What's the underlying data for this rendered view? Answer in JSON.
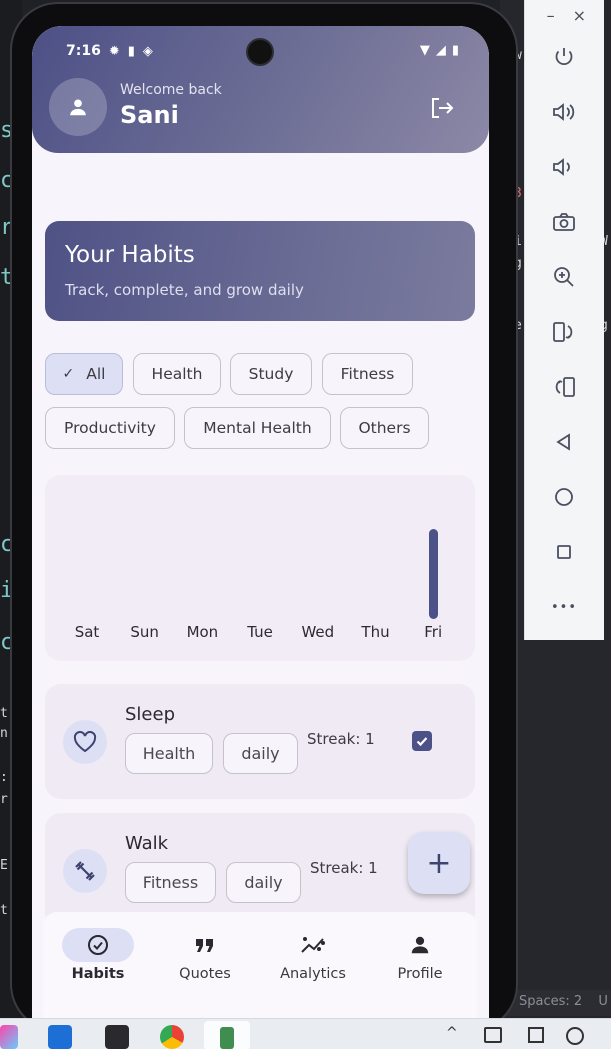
{
  "status_bar": {
    "time": "7:16"
  },
  "header": {
    "welcome": "Welcome back",
    "username": "Sani"
  },
  "hero": {
    "title": "Your Habits",
    "subtitle": "Track, complete, and grow daily"
  },
  "filters": {
    "selected": "All",
    "chips": [
      "All",
      "Health",
      "Study",
      "Fitness",
      "Productivity",
      "Mental Health",
      "Others"
    ]
  },
  "chart_data": {
    "type": "bar",
    "categories": [
      "Sat",
      "Sun",
      "Mon",
      "Tue",
      "Wed",
      "Thu",
      "Fri"
    ],
    "values": [
      0,
      0,
      0,
      0,
      0,
      0,
      1
    ],
    "title": "",
    "xlabel": "",
    "ylabel": "",
    "grid": false,
    "colors": {
      "bar": "#4c5288"
    }
  },
  "habits": [
    {
      "name": "Sleep",
      "category": "Health",
      "frequency": "daily",
      "streak": "Streak: 1",
      "completed": true,
      "icon": "heart-icon"
    },
    {
      "name": "Walk",
      "category": "Fitness",
      "frequency": "daily",
      "streak": "Streak: 1",
      "completed": false,
      "icon": "dumbbell-icon"
    }
  ],
  "fab": {
    "label": "+"
  },
  "nav": {
    "active": "Habits",
    "items": [
      {
        "label": "Habits",
        "icon": "check-circle-icon"
      },
      {
        "label": "Quotes",
        "icon": "quote-icon"
      },
      {
        "label": "Analytics",
        "icon": "analytics-icon"
      },
      {
        "label": "Profile",
        "icon": "person-icon"
      }
    ]
  },
  "emulator": {
    "minimize": "–",
    "close": "×",
    "more": "•••"
  },
  "editor": {
    "status_text": "Spaces: 2",
    "status_extra": "U",
    "left_glyphs": [
      "s",
      "c",
      "r",
      "t",
      "c",
      "i",
      "c",
      "t",
      "n",
      ":",
      "r",
      "E",
      "t"
    ],
    "right_glyphs": [
      "w",
      "3",
      "i",
      "g",
      "e",
      "W",
      "g"
    ]
  },
  "colors": {
    "primary": "#4c5288",
    "chip_selected": "#dde0f5",
    "surface": "#f8f4fb"
  }
}
